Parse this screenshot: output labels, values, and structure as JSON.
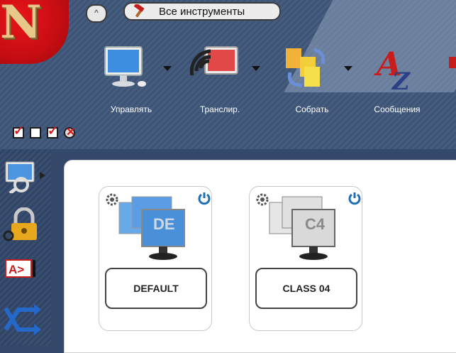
{
  "toolbar": {
    "all_tools_label": "Все инструменты",
    "up_button_glyph": "^",
    "tools": [
      {
        "label": "Управлять",
        "icon": "monitor-icon",
        "has_dropdown": true
      },
      {
        "label": "Транслир.",
        "icon": "broadcast-icon",
        "has_dropdown": true
      },
      {
        "label": "Собрать",
        "icon": "collect-files-icon",
        "has_dropdown": true
      },
      {
        "label": "Сообщения",
        "icon": "messages-az-icon",
        "has_dropdown": false
      }
    ],
    "checkboxes": [
      "checked",
      "unchecked",
      "checked",
      "disabled"
    ]
  },
  "logo": {
    "letter": "N"
  },
  "sidebar": {
    "items": [
      "magnifier-monitor-icon",
      "lock-icon",
      "text-cursor-icon",
      "shuffle-arrows-icon"
    ],
    "text_icon_label": "A>"
  },
  "groups": [
    {
      "code": "DE",
      "name": "DEFAULT",
      "color": "#4a90d9"
    },
    {
      "code": "C4",
      "name": "CLASS 04",
      "color": "#d9d9d9"
    }
  ],
  "colors": {
    "toolbar_bg": "#465d80",
    "accent_red": "#d21a1a",
    "power_blue": "#1f6fb8"
  }
}
